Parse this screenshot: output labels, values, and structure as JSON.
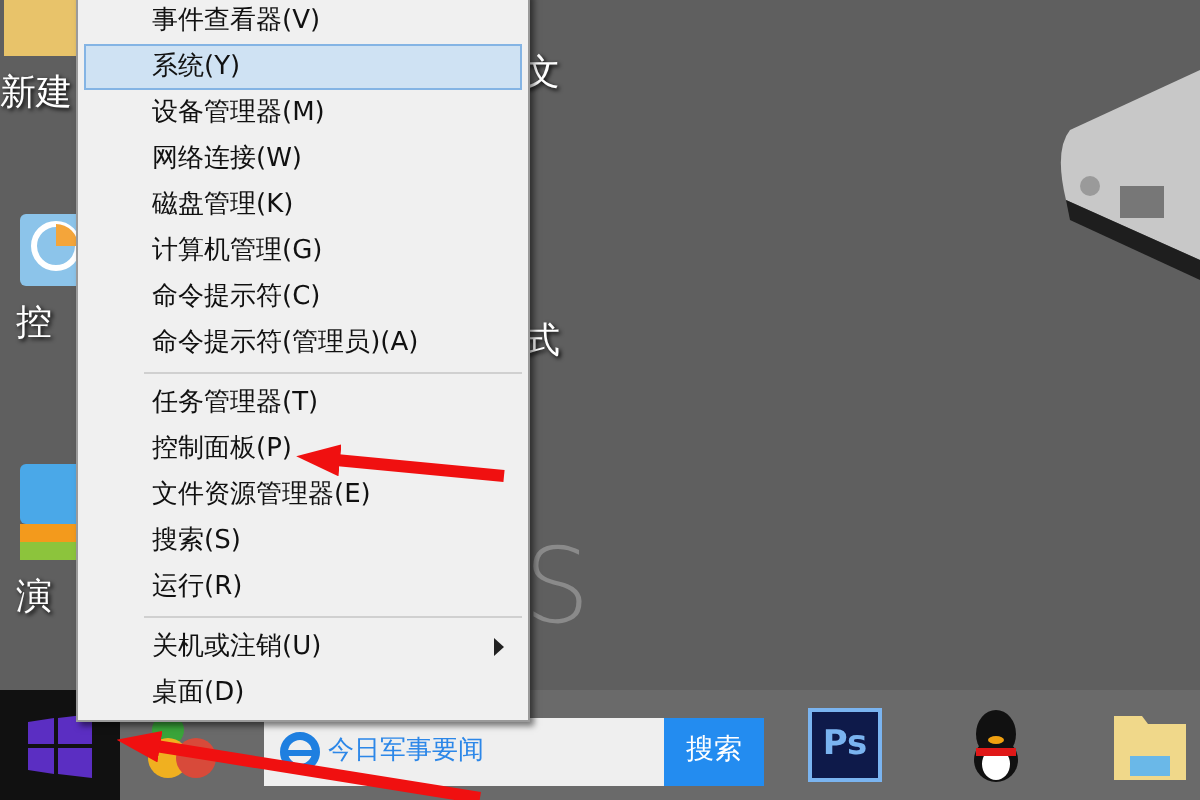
{
  "desktop": {
    "icons": [
      {
        "kind": "folder",
        "label": "新建"
      },
      {
        "kind": "text",
        "label": "文"
      },
      {
        "kind": "control",
        "label": "控"
      },
      {
        "kind": "text",
        "label": "式"
      },
      {
        "kind": "zip",
        "label": "演"
      }
    ],
    "wallpaper_text": "S"
  },
  "menu": {
    "groups": [
      {
        "items": [
          {
            "label": "事件查看器(V)",
            "selected": false,
            "has_submenu": false
          },
          {
            "label": "系统(Y)",
            "selected": true,
            "has_submenu": false
          },
          {
            "label": "设备管理器(M)",
            "selected": false,
            "has_submenu": false
          },
          {
            "label": "网络连接(W)",
            "selected": false,
            "has_submenu": false
          },
          {
            "label": "磁盘管理(K)",
            "selected": false,
            "has_submenu": false
          },
          {
            "label": "计算机管理(G)",
            "selected": false,
            "has_submenu": false
          },
          {
            "label": "命令提示符(C)",
            "selected": false,
            "has_submenu": false
          },
          {
            "label": "命令提示符(管理员)(A)",
            "selected": false,
            "has_submenu": false
          }
        ]
      },
      {
        "items": [
          {
            "label": "任务管理器(T)",
            "selected": false,
            "has_submenu": false
          },
          {
            "label": "控制面板(P)",
            "selected": false,
            "has_submenu": false
          },
          {
            "label": "文件资源管理器(E)",
            "selected": false,
            "has_submenu": false
          },
          {
            "label": "搜索(S)",
            "selected": false,
            "has_submenu": false
          },
          {
            "label": "运行(R)",
            "selected": false,
            "has_submenu": false
          }
        ]
      },
      {
        "items": [
          {
            "label": "关机或注销(U)",
            "selected": false,
            "has_submenu": true
          },
          {
            "label": "桌面(D)",
            "selected": false,
            "has_submenu": false
          }
        ]
      }
    ]
  },
  "taskbar": {
    "search": {
      "value": "今日军事要闻",
      "button": "搜索"
    },
    "ps_label": "Ps"
  }
}
